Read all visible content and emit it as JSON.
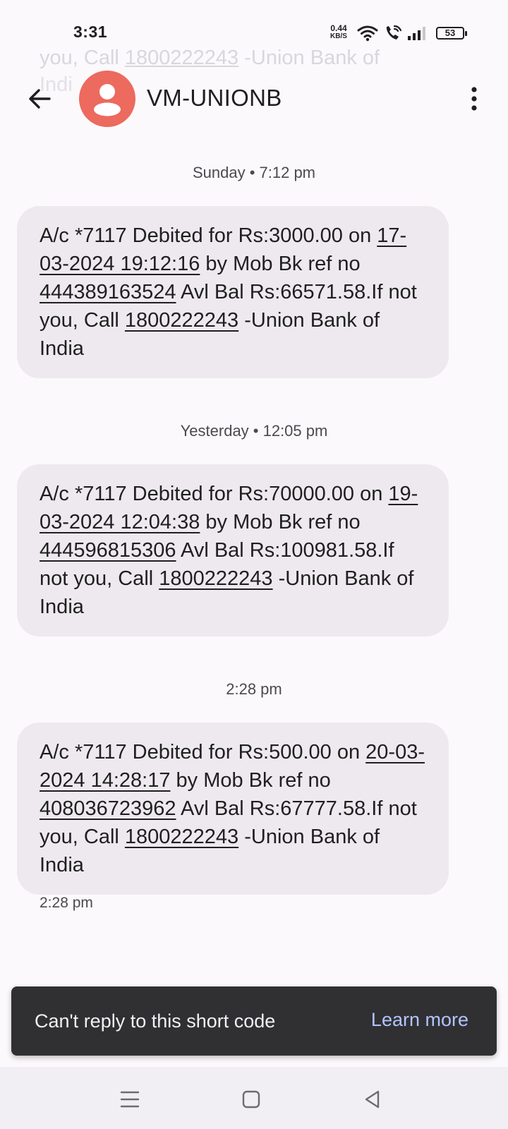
{
  "status_bar": {
    "time": "3:31",
    "net_speed_value": "0.44",
    "net_speed_unit": "KB/S",
    "battery": "53",
    "icons": [
      "wifi-icon",
      "wifi-call-icon",
      "signal-icon",
      "battery-icon"
    ]
  },
  "background_text": {
    "line1_prefix": "you, Call ",
    "line1_number": "1800222243",
    "line1_suffix": " -Union Bank of",
    "line2": "Indi"
  },
  "header": {
    "back_icon": "arrow-back-icon",
    "avatar_icon": "person-avatar-icon",
    "contact_name": "VM-UNIONB",
    "more_icon": "more-vert-icon"
  },
  "conversation": {
    "separators": [
      "Sunday • 7:12 pm",
      "Yesterday • 12:05 pm",
      "2:28 pm"
    ],
    "messages": [
      {
        "p1": "A/c *7117 Debited for Rs:3000.00 on ",
        "datetime": "17-03-2024 19:12:16",
        "p2": " by Mob Bk ref no ",
        "ref": "444389163524",
        "p3": " Avl Bal Rs:66571.58.If not you, Call ",
        "phone": "1800222243",
        "p4": " -Union Bank of India"
      },
      {
        "p1": "A/c *7117 Debited for Rs:70000.00 on ",
        "datetime": "19-03-2024 12:04:38",
        "p2": " by Mob Bk ref no ",
        "ref": "444596815306",
        "p3": " Avl Bal Rs:100981.58.If not you, Call ",
        "phone": "1800222243",
        "p4": " -Union Bank of India"
      },
      {
        "p1": "A/c *7117 Debited for Rs:500.00 on ",
        "datetime": "20-03-2024 14:28:17",
        "p2": " by Mob Bk ref no ",
        "ref": "408036723962",
        "p3": " Avl Bal Rs:67777.58.If not you, Call ",
        "phone": "1800222243",
        "p4": " -Union Bank of India"
      }
    ],
    "last_message_time": "2:28 pm"
  },
  "snackbar": {
    "text": "Can't reply to this short code",
    "action": "Learn more"
  },
  "nav_bar": {
    "icons": [
      "recents-menu-icon",
      "home-square-icon",
      "back-triangle-icon"
    ]
  },
  "colors": {
    "avatar": "#ec6a5e",
    "bubble": "#ede9ee",
    "snackbar": "#303033",
    "snackbar_action": "#b2c4ff",
    "background": "#fcf9fc"
  }
}
